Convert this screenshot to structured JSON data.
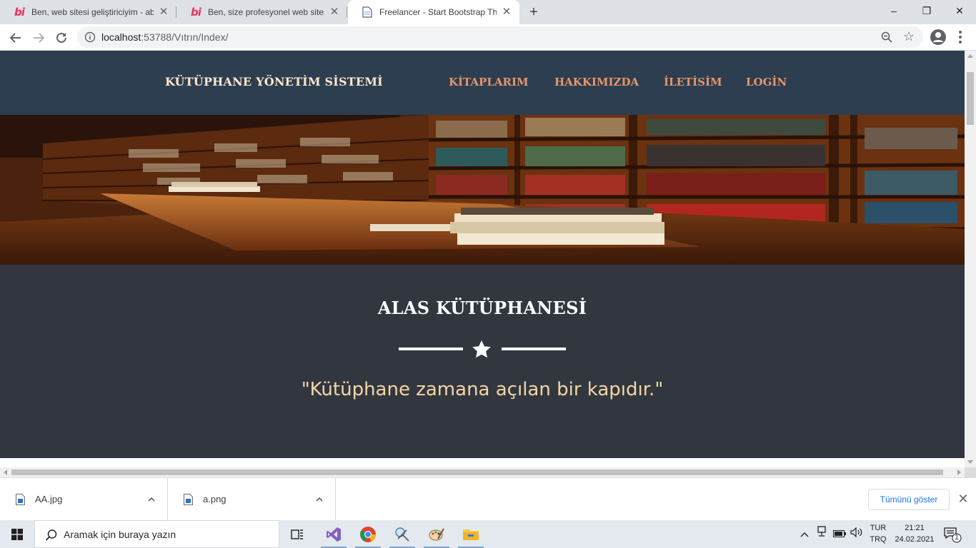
{
  "browser": {
    "tabs": [
      {
        "label": "Ben, web sitesi geliştiriciyim - abc",
        "icon": "bionluk-icon"
      },
      {
        "label": "Ben, size profesyonel web sitesi h",
        "icon": "bionluk-icon"
      },
      {
        "label": "Freelancer - Start Bootstrap Them",
        "icon": "document-icon"
      }
    ],
    "new_tab": "+",
    "window": {
      "minimize": "–",
      "restore": "❐",
      "close": "✕"
    },
    "url_host": "localhost",
    "url_rest": ":53788/Vıtrın/Index/"
  },
  "site": {
    "brand": "KÜTÜPHANE YÖNETİM SİSTEMİ",
    "nav": [
      "KİTAPLARIM",
      "HAKKIMIZDA",
      "İLETİSİM",
      "LOGİN"
    ],
    "hero_image": "library bookshelves photo",
    "title": "ALAS KÜTÜPHANESİ",
    "quote": "\"Kütüphane zamana açılan bir kapıdır.\"",
    "colors": {
      "nav_bg": "#2c3e50",
      "masthead_bg": "#32373f",
      "nav_link": "#e9956a",
      "brand": "#ffe8cc",
      "quote": "#f5d6a4"
    }
  },
  "downloads": {
    "items": [
      {
        "name": "AA.jpg"
      },
      {
        "name": "a.png"
      }
    ],
    "show_all": "Tümünü göster",
    "close": "✕"
  },
  "taskbar": {
    "search_placeholder": "Aramak için buraya yazın",
    "lang_top": "TUR",
    "lang_bottom": "TRQ",
    "time": "21:21",
    "date": "24.02.2021",
    "notification_count": "1"
  }
}
